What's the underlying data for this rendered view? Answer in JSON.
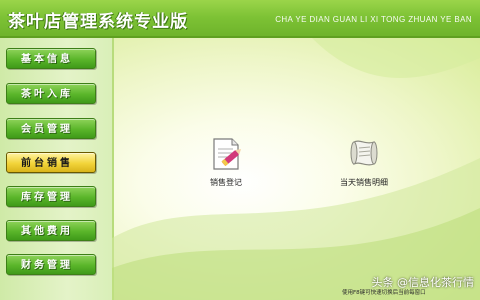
{
  "header": {
    "title": "茶叶店管理系统专业版",
    "subtitle": "CHA YE DIAN GUAN LI XI TONG ZHUAN YE BAN"
  },
  "sidebar": {
    "items": [
      {
        "label": "基本信息",
        "active": false
      },
      {
        "label": "茶叶入库",
        "active": false
      },
      {
        "label": "会员管理",
        "active": false
      },
      {
        "label": "前台销售",
        "active": true
      },
      {
        "label": "库存管理",
        "active": false
      },
      {
        "label": "其他费用",
        "active": false
      },
      {
        "label": "财务管理",
        "active": false
      }
    ]
  },
  "main": {
    "actions": [
      {
        "label": "销售登记",
        "icon": "pencil-note-icon"
      },
      {
        "label": "当天销售明细",
        "icon": "scroll-icon"
      }
    ],
    "status": "使用F8键可快速切换后当前每窗口"
  },
  "watermark": "头条 @信息化茶行情",
  "colors": {
    "header_green": "#7dc235",
    "nav_green": "#5ab52a",
    "nav_active": "#f2d43a",
    "panel_light": "#fbfde9"
  }
}
